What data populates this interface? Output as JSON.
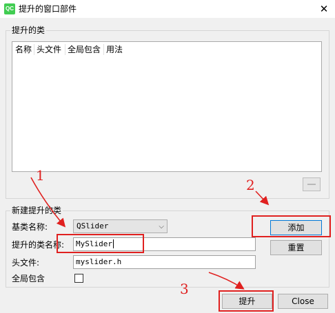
{
  "window": {
    "title": "提升的窗口部件",
    "app_icon_text": "QC",
    "close_glyph": "✕"
  },
  "promoted_group": {
    "title": "提升的类",
    "columns": [
      "名称",
      "头文件",
      "全局包含",
      "用法"
    ]
  },
  "new_group": {
    "title": "新建提升的类",
    "base_class_label": "基类名称:",
    "base_class_value": "QSlider",
    "class_name_label": "提升的类名称:",
    "class_name_value": "MySlider",
    "header_label": "头文件:",
    "header_value": "myslider.h",
    "global_include_label": "全局包含",
    "global_include_checked": false
  },
  "buttons": {
    "add": "添加",
    "reset": "重置",
    "promote": "提升",
    "close": "Close"
  },
  "annotations": {
    "step1": "1",
    "step2": "2",
    "step3": "3",
    "color": "#e0201f"
  },
  "colors": {
    "accent": "#0078d7",
    "app_icon": "#41cd52"
  }
}
